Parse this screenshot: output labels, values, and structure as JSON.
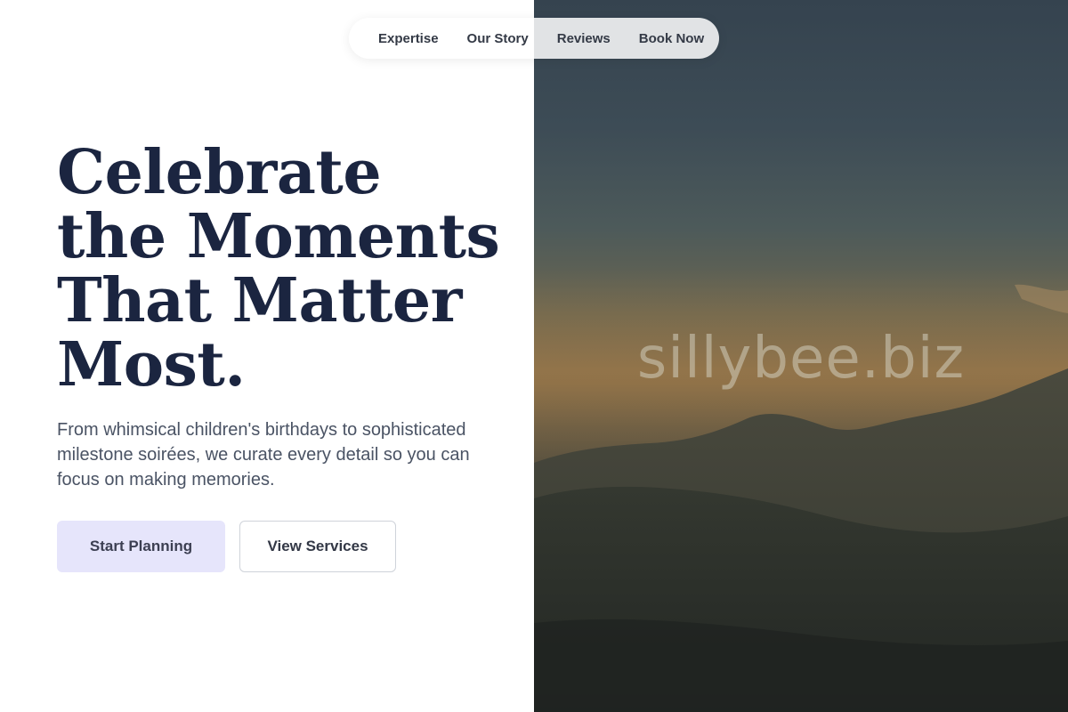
{
  "nav": {
    "items": [
      {
        "label": "Expertise"
      },
      {
        "label": "Our Story"
      },
      {
        "label": "Reviews"
      },
      {
        "label": "Book Now"
      }
    ]
  },
  "hero": {
    "headline": "Celebrate the Moments That Matter Most.",
    "subtext": "From whimsical children's birthdays to sophisticated milestone soirées, we curate every detail so you can focus on making memories.",
    "primary_cta": "Start Planning",
    "secondary_cta": "View Services"
  },
  "image_panel": {
    "watermark": "sillybee.biz",
    "subject": "mountain-sunset-photo"
  },
  "colors": {
    "headline": "#1b2540",
    "primary_button_bg": "#e6e5fb",
    "body_text": "#4a5364"
  }
}
